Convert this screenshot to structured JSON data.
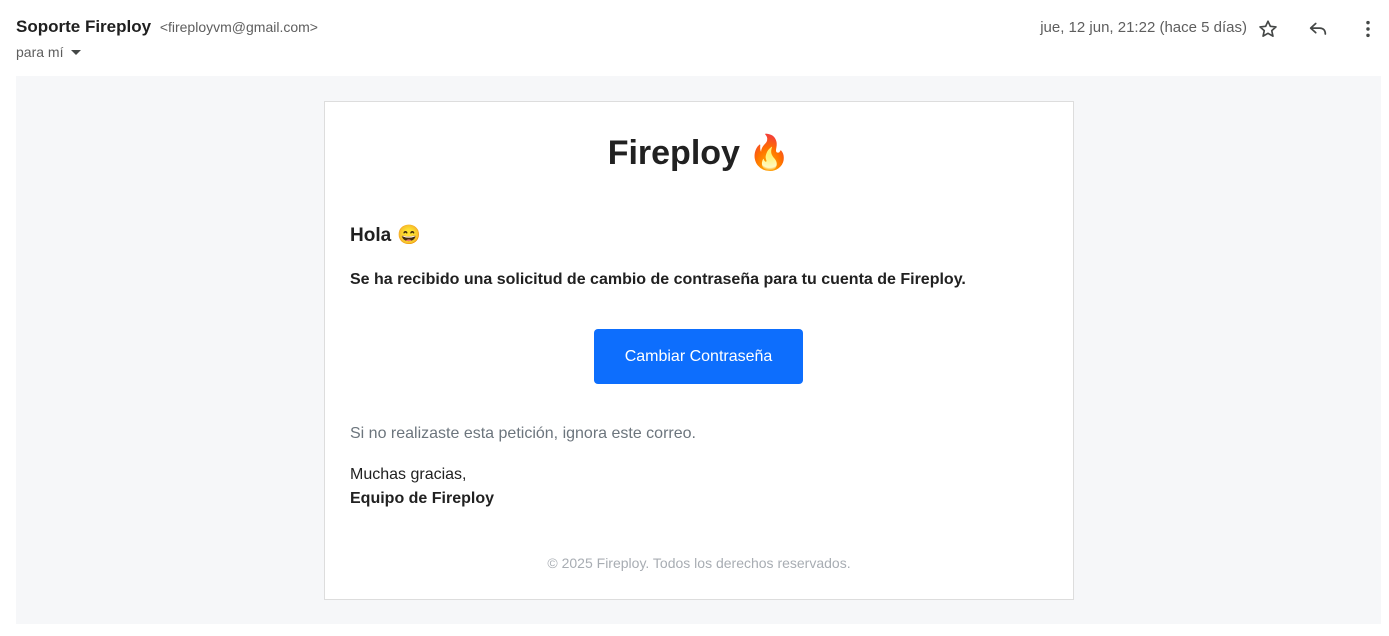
{
  "header": {
    "sender_name": "Soporte Fireploy",
    "sender_email": "<fireployvm@gmail.com>",
    "recipient": "para mí",
    "date": "jue, 12 jun, 21:22 (hace 5 días)",
    "icons": {
      "star": "star-icon",
      "reply": "reply-icon",
      "more": "more-vert-icon",
      "recipient_caret": "caret-down-icon"
    }
  },
  "email": {
    "brand": "Fireploy",
    "brand_emoji": "🔥",
    "greeting": "Hola",
    "greeting_emoji": "😄",
    "message": "Se ha recibido una solicitud de cambio de contraseña para tu cuenta de Fireploy.",
    "button_label": "Cambiar Contraseña",
    "ignore_text": "Si no realizaste esta petición, ignora este correo.",
    "thanks": "Muchas gracias,",
    "team": "Equipo de Fireploy",
    "footer": "© 2025 Fireploy. Todos los derechos reservados."
  },
  "colors": {
    "button": "#0d6efd",
    "muted_text": "#6c757d",
    "footer_text": "#a8adb3",
    "body_background": "#f6f7f9"
  }
}
